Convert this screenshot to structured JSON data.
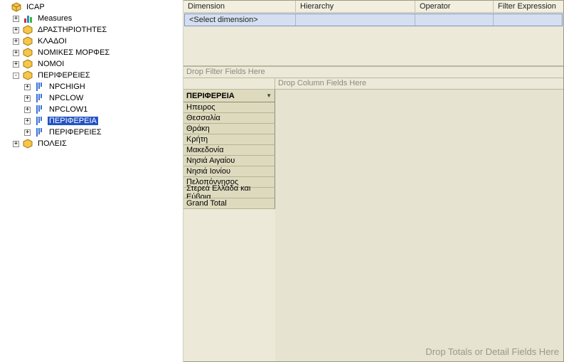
{
  "tree": {
    "root": {
      "label": "ICAP"
    },
    "measures": {
      "label": "Measures"
    },
    "dims": {
      "drastiriotites": "ΔΡΑΣΤΗΡΙΟΤΗΤΕΣ",
      "kladoi": "ΚΛΑΔΟΙ",
      "nomikes": "ΝΟΜΙΚΕΣ ΜΟΡΦΕΣ",
      "nomoi": "ΝΟΜΟΙ",
      "perifereies": "ΠΕΡΙΦΕΡΕΙΕΣ",
      "poleis": "ΠΟΛΕΙΣ"
    },
    "perifereies_children": {
      "npchigh": "NPCHIGH",
      "npclow": "NPCLOW",
      "npclow1": "NPCLOW1",
      "perifereia": "ΠΕΡΙΦΕΡΕΙΑ",
      "perifereies2": "ΠΕΡΙΦΕΡΕΙΕΣ"
    }
  },
  "filterGrid": {
    "headers": {
      "dimension": "Dimension",
      "hierarchy": "Hierarchy",
      "operator": "Operator",
      "filterExpression": "Filter Expression"
    },
    "row": {
      "dimension": "<Select dimension>"
    }
  },
  "pivot": {
    "dropFilter": "Drop Filter Fields Here",
    "dropColumn": "Drop Column Fields Here",
    "dropDetail": "Drop Totals or Detail Fields Here",
    "rowField": "ΠΕΡΙΦΕΡΕΙΑ",
    "rows": [
      "Ηπειρος",
      "Θεσσαλία",
      "Θράκη",
      "Κρήτη",
      "Μακεδονία",
      "Νησιά Αιγαίου",
      "Νησιά Ιονίου",
      "Πελοπόννησος",
      "Στερεά Ελλάδα και Εύβοια",
      "Grand Total"
    ]
  }
}
